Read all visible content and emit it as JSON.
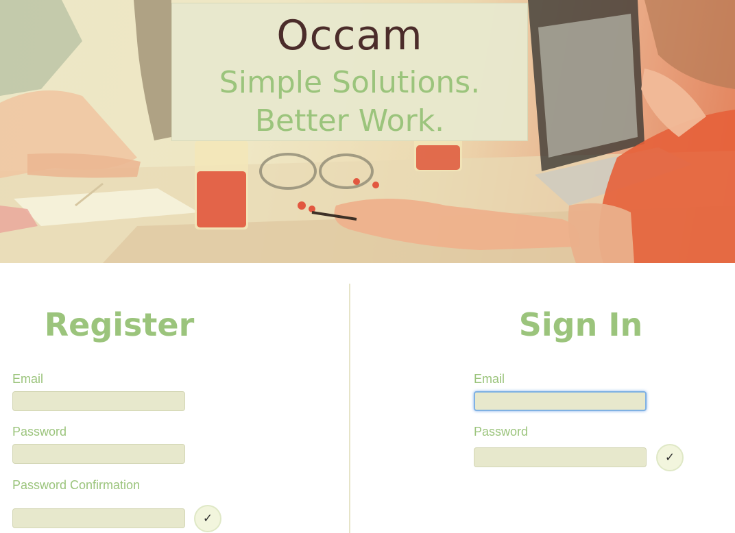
{
  "header": {
    "brand": "Occam",
    "tagline_line1": "Simple Solutions.",
    "tagline_line2": "Better Work."
  },
  "register": {
    "title": "Register",
    "email_label": "Email",
    "email_value": "",
    "password_label": "Password",
    "password_value": "",
    "password_confirmation_label": "Password Confirmation",
    "password_confirmation_value": "",
    "submit_icon": "checkmark-icon",
    "submit_glyph": "✓"
  },
  "sign_in": {
    "title": "Sign In",
    "email_label": "Email",
    "email_value": "",
    "password_label": "Password",
    "password_value": "",
    "submit_icon": "checkmark-icon",
    "submit_glyph": "✓"
  },
  "colors": {
    "accent_green": "#9bc47c",
    "brand_brown": "#4b2c2a",
    "field_bg": "#e7e8cc",
    "focus_blue": "#7fb1e3"
  }
}
